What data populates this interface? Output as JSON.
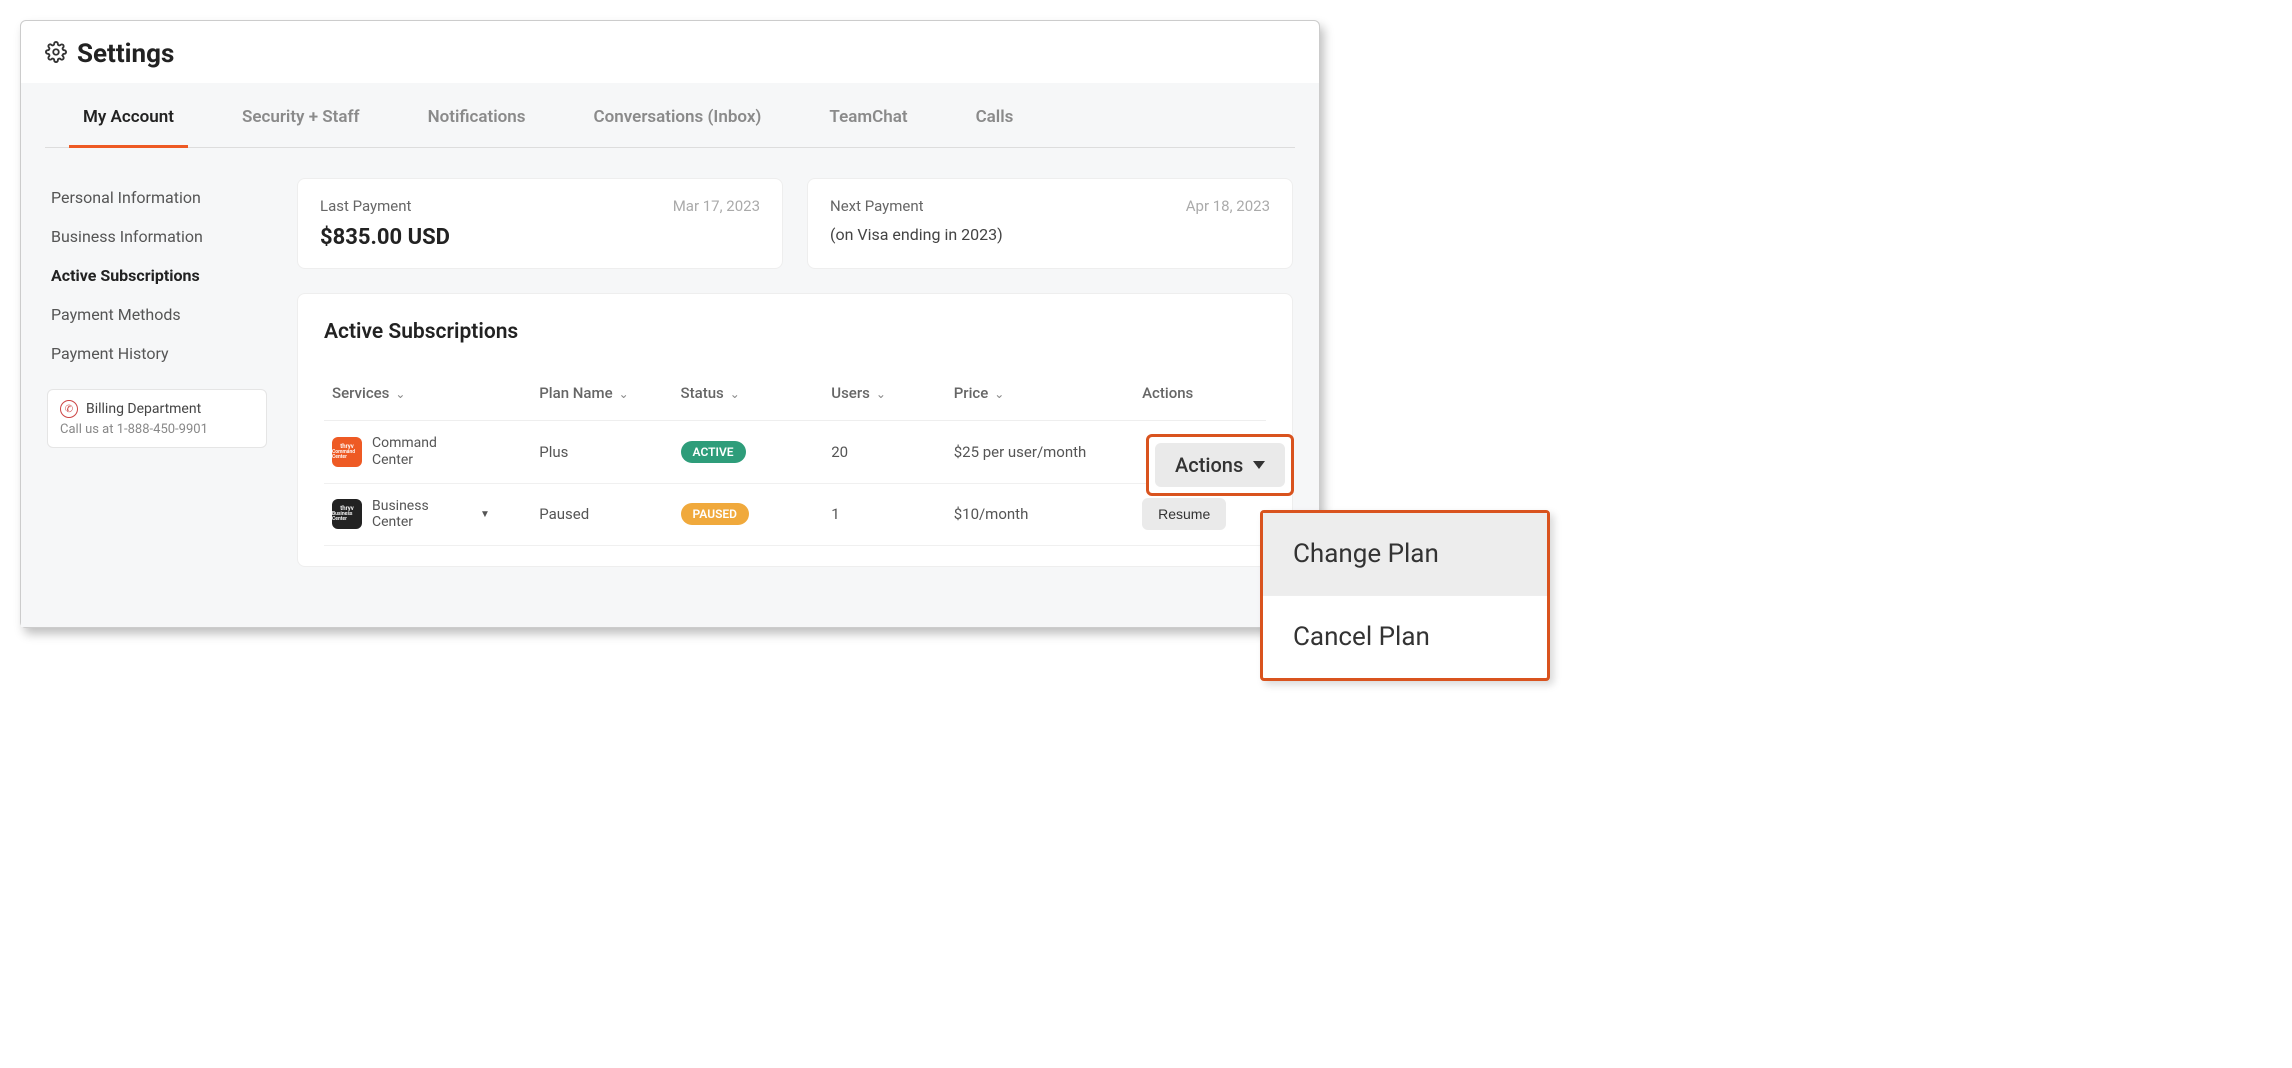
{
  "header": {
    "title": "Settings"
  },
  "tabs": [
    {
      "label": "My Account",
      "active": true
    },
    {
      "label": "Security + Staff"
    },
    {
      "label": "Notifications"
    },
    {
      "label": "Conversations (Inbox)"
    },
    {
      "label": "TeamChat"
    },
    {
      "label": "Calls"
    }
  ],
  "sidebar": {
    "items": [
      {
        "label": "Personal Information"
      },
      {
        "label": "Business Information"
      },
      {
        "label": "Active Subscriptions",
        "active": true
      },
      {
        "label": "Payment Methods"
      },
      {
        "label": "Payment History"
      }
    ],
    "billing": {
      "title": "Billing Department",
      "subtitle": "Call us at 1-888-450-9901"
    }
  },
  "summary": {
    "last": {
      "label": "Last Payment",
      "date": "Mar 17, 2023",
      "amount": "$835.00 USD"
    },
    "next": {
      "label": "Next Payment",
      "date": "Apr 18, 2023",
      "detail": "(on Visa ending in 2023)"
    }
  },
  "subs": {
    "title": "Active Subscriptions",
    "columns": {
      "services": "Services",
      "plan": "Plan Name",
      "status": "Status",
      "users": "Users",
      "price": "Price",
      "actions": "Actions"
    },
    "rows": [
      {
        "service": "Command Center",
        "brand": "thryv",
        "iconColor": "orange",
        "plan": "Plus",
        "status": "ACTIVE",
        "statusClass": "active",
        "users": "20",
        "price": "$25 per user/month",
        "action": "Actions"
      },
      {
        "service": "Business Center",
        "brand": "thryv",
        "iconColor": "black",
        "plan": "Paused",
        "status": "PAUSED",
        "statusClass": "paused",
        "users": "1",
        "price": "$10/month",
        "action": "Resume",
        "expandable": true
      }
    ]
  },
  "overlay": {
    "button": "Actions",
    "menu": [
      "Change Plan",
      "Cancel Plan"
    ]
  }
}
